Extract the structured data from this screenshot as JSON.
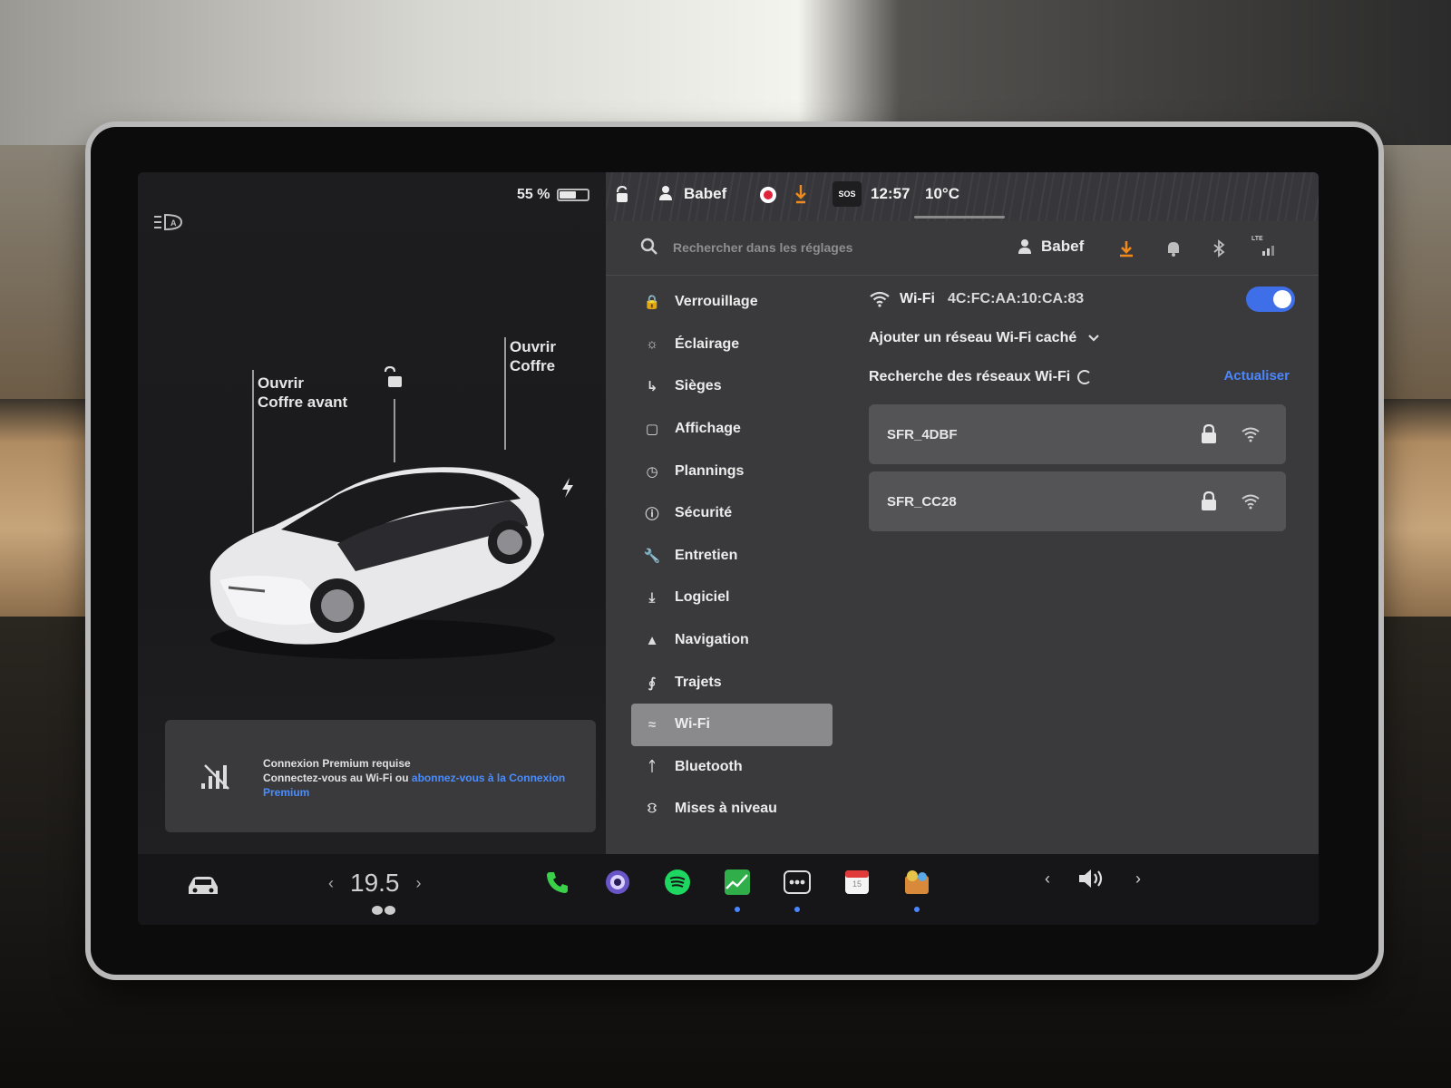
{
  "car_panel": {
    "battery_percent": "55 %",
    "battery_level": 0.55,
    "front_trunk_label_1": "Ouvrir",
    "front_trunk_label_2": "Coffre avant",
    "trunk_label_1": "Ouvrir",
    "trunk_label_2": "Coffre",
    "premium": {
      "title": "Connexion Premium requise",
      "text": "Connectez-vous au Wi-Fi ou ",
      "link": "abonnez-vous à la Connexion Premium"
    }
  },
  "status_bar": {
    "user": "Babef",
    "sos": "SOS",
    "time": "12:57",
    "temperature": "10°C"
  },
  "settings_header": {
    "search_placeholder": "Rechercher dans les réglages",
    "user": "Babef",
    "signal_label": "LTE"
  },
  "nav": {
    "items": [
      {
        "label": "Verrouillage",
        "icon": "lock-icon"
      },
      {
        "label": "Éclairage",
        "icon": "sun-icon"
      },
      {
        "label": "Sièges",
        "icon": "seat-icon"
      },
      {
        "label": "Affichage",
        "icon": "display-icon"
      },
      {
        "label": "Plannings",
        "icon": "alarm-clock-icon"
      },
      {
        "label": "Sécurité",
        "icon": "alert-circle-icon"
      },
      {
        "label": "Entretien",
        "icon": "wrench-icon"
      },
      {
        "label": "Logiciel",
        "icon": "download-icon"
      },
      {
        "label": "Navigation",
        "icon": "navigation-arrow-icon"
      },
      {
        "label": "Trajets",
        "icon": "trips-icon"
      },
      {
        "label": "Wi-Fi",
        "icon": "wifi-icon"
      },
      {
        "label": "Bluetooth",
        "icon": "bluetooth-icon"
      },
      {
        "label": "Mises à niveau",
        "icon": "bag-icon"
      }
    ],
    "active_index": 10
  },
  "wifi": {
    "title": "Wi-Fi",
    "mac": "4C:FC:AA:10:CA:83",
    "enabled": true,
    "hidden_network": "Ajouter un réseau Wi-Fi caché",
    "searching": "Recherche des réseaux Wi-Fi",
    "refresh": "Actualiser",
    "networks": [
      {
        "ssid": "SFR_4DBF",
        "secured": true
      },
      {
        "ssid": "SFR_CC28",
        "secured": true
      }
    ]
  },
  "dock": {
    "temperature": "19.5",
    "apps": [
      "phone-icon",
      "camera-icon",
      "spotify-icon",
      "stocks-icon",
      "more-icon",
      "calendar-icon",
      "toybox-icon"
    ],
    "calendar_day": "15"
  },
  "colors": {
    "accent": "#4a86ff",
    "toggle_on": "#3e6ee8",
    "record": "#e0223a",
    "download_orange": "#f08a1c",
    "phone_green": "#3ad04a",
    "spotify_green": "#1ed760"
  }
}
